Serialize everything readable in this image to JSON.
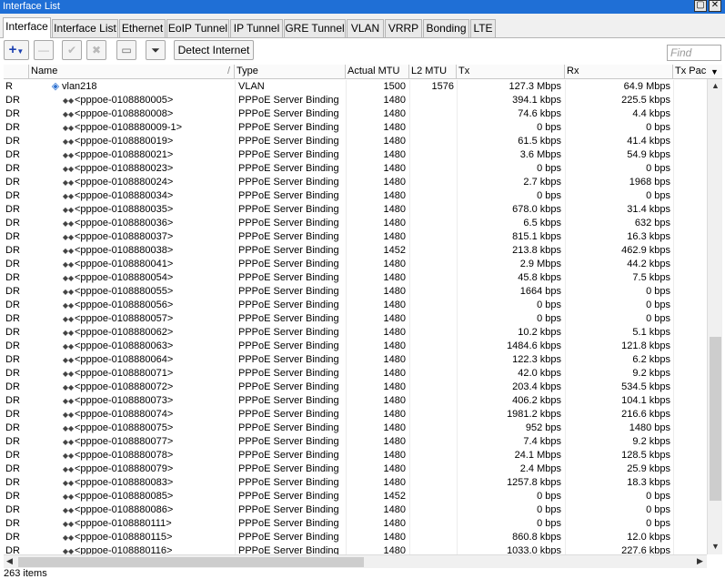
{
  "window": {
    "title": "Interface List"
  },
  "tabs": [
    "Interface",
    "Interface List",
    "Ethernet",
    "EoIP Tunnel",
    "IP Tunnel",
    "GRE Tunnel",
    "VLAN",
    "VRRP",
    "Bonding",
    "LTE"
  ],
  "toolbar": {
    "detect_label": "Detect Internet",
    "find_placeholder": "Find"
  },
  "columns": [
    "Name",
    "Type",
    "Actual MTU",
    "L2 MTU",
    "Tx",
    "Rx",
    "Tx Pack"
  ],
  "rows": [
    {
      "f": "R",
      "name": "vlan218",
      "type": "VLAN",
      "mtu": "1500",
      "l2": "1576",
      "tx": "127.3 Mbps",
      "rx": "64.9 Mbps"
    },
    {
      "f": "DR",
      "name": "<pppoe-0108880005>",
      "type": "PPPoE Server Binding",
      "mtu": "1480",
      "l2": "",
      "tx": "394.1 kbps",
      "rx": "225.5 kbps"
    },
    {
      "f": "DR",
      "name": "<pppoe-0108880008>",
      "type": "PPPoE Server Binding",
      "mtu": "1480",
      "l2": "",
      "tx": "74.6 kbps",
      "rx": "4.4 kbps"
    },
    {
      "f": "DR",
      "name": "<pppoe-0108880009-1>",
      "type": "PPPoE Server Binding",
      "mtu": "1480",
      "l2": "",
      "tx": "0 bps",
      "rx": "0 bps"
    },
    {
      "f": "DR",
      "name": "<pppoe-0108880019>",
      "type": "PPPoE Server Binding",
      "mtu": "1480",
      "l2": "",
      "tx": "61.5 kbps",
      "rx": "41.4 kbps"
    },
    {
      "f": "DR",
      "name": "<pppoe-0108880021>",
      "type": "PPPoE Server Binding",
      "mtu": "1480",
      "l2": "",
      "tx": "3.6 Mbps",
      "rx": "54.9 kbps"
    },
    {
      "f": "DR",
      "name": "<pppoe-0108880023>",
      "type": "PPPoE Server Binding",
      "mtu": "1480",
      "l2": "",
      "tx": "0 bps",
      "rx": "0 bps"
    },
    {
      "f": "DR",
      "name": "<pppoe-0108880024>",
      "type": "PPPoE Server Binding",
      "mtu": "1480",
      "l2": "",
      "tx": "2.7 kbps",
      "rx": "1968 bps"
    },
    {
      "f": "DR",
      "name": "<pppoe-0108880034>",
      "type": "PPPoE Server Binding",
      "mtu": "1480",
      "l2": "",
      "tx": "0 bps",
      "rx": "0 bps"
    },
    {
      "f": "DR",
      "name": "<pppoe-0108880035>",
      "type": "PPPoE Server Binding",
      "mtu": "1480",
      "l2": "",
      "tx": "678.0 kbps",
      "rx": "31.4 kbps"
    },
    {
      "f": "DR",
      "name": "<pppoe-0108880036>",
      "type": "PPPoE Server Binding",
      "mtu": "1480",
      "l2": "",
      "tx": "6.5 kbps",
      "rx": "632 bps"
    },
    {
      "f": "DR",
      "name": "<pppoe-0108880037>",
      "type": "PPPoE Server Binding",
      "mtu": "1480",
      "l2": "",
      "tx": "815.1 kbps",
      "rx": "16.3 kbps"
    },
    {
      "f": "DR",
      "name": "<pppoe-0108880038>",
      "type": "PPPoE Server Binding",
      "mtu": "1452",
      "l2": "",
      "tx": "213.8 kbps",
      "rx": "462.9 kbps"
    },
    {
      "f": "DR",
      "name": "<pppoe-0108880041>",
      "type": "PPPoE Server Binding",
      "mtu": "1480",
      "l2": "",
      "tx": "2.9 Mbps",
      "rx": "44.2 kbps"
    },
    {
      "f": "DR",
      "name": "<pppoe-0108880054>",
      "type": "PPPoE Server Binding",
      "mtu": "1480",
      "l2": "",
      "tx": "45.8 kbps",
      "rx": "7.5 kbps"
    },
    {
      "f": "DR",
      "name": "<pppoe-0108880055>",
      "type": "PPPoE Server Binding",
      "mtu": "1480",
      "l2": "",
      "tx": "1664 bps",
      "rx": "0 bps"
    },
    {
      "f": "DR",
      "name": "<pppoe-0108880056>",
      "type": "PPPoE Server Binding",
      "mtu": "1480",
      "l2": "",
      "tx": "0 bps",
      "rx": "0 bps"
    },
    {
      "f": "DR",
      "name": "<pppoe-0108880057>",
      "type": "PPPoE Server Binding",
      "mtu": "1480",
      "l2": "",
      "tx": "0 bps",
      "rx": "0 bps"
    },
    {
      "f": "DR",
      "name": "<pppoe-0108880062>",
      "type": "PPPoE Server Binding",
      "mtu": "1480",
      "l2": "",
      "tx": "10.2 kbps",
      "rx": "5.1 kbps"
    },
    {
      "f": "DR",
      "name": "<pppoe-0108880063>",
      "type": "PPPoE Server Binding",
      "mtu": "1480",
      "l2": "",
      "tx": "1484.6 kbps",
      "rx": "121.8 kbps"
    },
    {
      "f": "DR",
      "name": "<pppoe-0108880064>",
      "type": "PPPoE Server Binding",
      "mtu": "1480",
      "l2": "",
      "tx": "122.3 kbps",
      "rx": "6.2 kbps"
    },
    {
      "f": "DR",
      "name": "<pppoe-0108880071>",
      "type": "PPPoE Server Binding",
      "mtu": "1480",
      "l2": "",
      "tx": "42.0 kbps",
      "rx": "9.2 kbps"
    },
    {
      "f": "DR",
      "name": "<pppoe-0108880072>",
      "type": "PPPoE Server Binding",
      "mtu": "1480",
      "l2": "",
      "tx": "203.4 kbps",
      "rx": "534.5 kbps"
    },
    {
      "f": "DR",
      "name": "<pppoe-0108880073>",
      "type": "PPPoE Server Binding",
      "mtu": "1480",
      "l2": "",
      "tx": "406.2 kbps",
      "rx": "104.1 kbps"
    },
    {
      "f": "DR",
      "name": "<pppoe-0108880074>",
      "type": "PPPoE Server Binding",
      "mtu": "1480",
      "l2": "",
      "tx": "1981.2 kbps",
      "rx": "216.6 kbps"
    },
    {
      "f": "DR",
      "name": "<pppoe-0108880075>",
      "type": "PPPoE Server Binding",
      "mtu": "1480",
      "l2": "",
      "tx": "952 bps",
      "rx": "1480 bps"
    },
    {
      "f": "DR",
      "name": "<pppoe-0108880077>",
      "type": "PPPoE Server Binding",
      "mtu": "1480",
      "l2": "",
      "tx": "7.4 kbps",
      "rx": "9.2 kbps"
    },
    {
      "f": "DR",
      "name": "<pppoe-0108880078>",
      "type": "PPPoE Server Binding",
      "mtu": "1480",
      "l2": "",
      "tx": "24.1 Mbps",
      "rx": "128.5 kbps"
    },
    {
      "f": "DR",
      "name": "<pppoe-0108880079>",
      "type": "PPPoE Server Binding",
      "mtu": "1480",
      "l2": "",
      "tx": "2.4 Mbps",
      "rx": "25.9 kbps"
    },
    {
      "f": "DR",
      "name": "<pppoe-0108880083>",
      "type": "PPPoE Server Binding",
      "mtu": "1480",
      "l2": "",
      "tx": "1257.8 kbps",
      "rx": "18.3 kbps"
    },
    {
      "f": "DR",
      "name": "<pppoe-0108880085>",
      "type": "PPPoE Server Binding",
      "mtu": "1452",
      "l2": "",
      "tx": "0 bps",
      "rx": "0 bps"
    },
    {
      "f": "DR",
      "name": "<pppoe-0108880086>",
      "type": "PPPoE Server Binding",
      "mtu": "1480",
      "l2": "",
      "tx": "0 bps",
      "rx": "0 bps"
    },
    {
      "f": "DR",
      "name": "<pppoe-0108880111>",
      "type": "PPPoE Server Binding",
      "mtu": "1480",
      "l2": "",
      "tx": "0 bps",
      "rx": "0 bps"
    },
    {
      "f": "DR",
      "name": "<pppoe-0108880115>",
      "type": "PPPoE Server Binding",
      "mtu": "1480",
      "l2": "",
      "tx": "860.8 kbps",
      "rx": "12.0 kbps"
    },
    {
      "f": "DR",
      "name": "<pppoe-0108880116>",
      "type": "PPPoE Server Binding",
      "mtu": "1480",
      "l2": "",
      "tx": "1033.0 kbps",
      "rx": "227.6 kbps"
    }
  ],
  "status": {
    "items": "263 items"
  }
}
